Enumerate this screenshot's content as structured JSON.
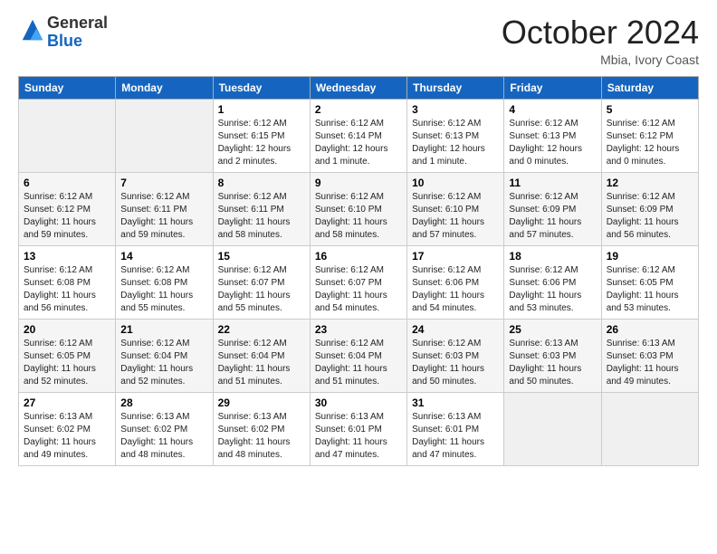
{
  "logo": {
    "general": "General",
    "blue": "Blue"
  },
  "header": {
    "month": "October 2024",
    "location": "Mbia, Ivory Coast"
  },
  "days_of_week": [
    "Sunday",
    "Monday",
    "Tuesday",
    "Wednesday",
    "Thursday",
    "Friday",
    "Saturday"
  ],
  "weeks": [
    [
      {
        "day": "",
        "info": ""
      },
      {
        "day": "",
        "info": ""
      },
      {
        "day": "1",
        "info": "Sunrise: 6:12 AM\nSunset: 6:15 PM\nDaylight: 12 hours and 2 minutes."
      },
      {
        "day": "2",
        "info": "Sunrise: 6:12 AM\nSunset: 6:14 PM\nDaylight: 12 hours and 1 minute."
      },
      {
        "day": "3",
        "info": "Sunrise: 6:12 AM\nSunset: 6:13 PM\nDaylight: 12 hours and 1 minute."
      },
      {
        "day": "4",
        "info": "Sunrise: 6:12 AM\nSunset: 6:13 PM\nDaylight: 12 hours and 0 minutes."
      },
      {
        "day": "5",
        "info": "Sunrise: 6:12 AM\nSunset: 6:12 PM\nDaylight: 12 hours and 0 minutes."
      }
    ],
    [
      {
        "day": "6",
        "info": "Sunrise: 6:12 AM\nSunset: 6:12 PM\nDaylight: 11 hours and 59 minutes."
      },
      {
        "day": "7",
        "info": "Sunrise: 6:12 AM\nSunset: 6:11 PM\nDaylight: 11 hours and 59 minutes."
      },
      {
        "day": "8",
        "info": "Sunrise: 6:12 AM\nSunset: 6:11 PM\nDaylight: 11 hours and 58 minutes."
      },
      {
        "day": "9",
        "info": "Sunrise: 6:12 AM\nSunset: 6:10 PM\nDaylight: 11 hours and 58 minutes."
      },
      {
        "day": "10",
        "info": "Sunrise: 6:12 AM\nSunset: 6:10 PM\nDaylight: 11 hours and 57 minutes."
      },
      {
        "day": "11",
        "info": "Sunrise: 6:12 AM\nSunset: 6:09 PM\nDaylight: 11 hours and 57 minutes."
      },
      {
        "day": "12",
        "info": "Sunrise: 6:12 AM\nSunset: 6:09 PM\nDaylight: 11 hours and 56 minutes."
      }
    ],
    [
      {
        "day": "13",
        "info": "Sunrise: 6:12 AM\nSunset: 6:08 PM\nDaylight: 11 hours and 56 minutes."
      },
      {
        "day": "14",
        "info": "Sunrise: 6:12 AM\nSunset: 6:08 PM\nDaylight: 11 hours and 55 minutes."
      },
      {
        "day": "15",
        "info": "Sunrise: 6:12 AM\nSunset: 6:07 PM\nDaylight: 11 hours and 55 minutes."
      },
      {
        "day": "16",
        "info": "Sunrise: 6:12 AM\nSunset: 6:07 PM\nDaylight: 11 hours and 54 minutes."
      },
      {
        "day": "17",
        "info": "Sunrise: 6:12 AM\nSunset: 6:06 PM\nDaylight: 11 hours and 54 minutes."
      },
      {
        "day": "18",
        "info": "Sunrise: 6:12 AM\nSunset: 6:06 PM\nDaylight: 11 hours and 53 minutes."
      },
      {
        "day": "19",
        "info": "Sunrise: 6:12 AM\nSunset: 6:05 PM\nDaylight: 11 hours and 53 minutes."
      }
    ],
    [
      {
        "day": "20",
        "info": "Sunrise: 6:12 AM\nSunset: 6:05 PM\nDaylight: 11 hours and 52 minutes."
      },
      {
        "day": "21",
        "info": "Sunrise: 6:12 AM\nSunset: 6:04 PM\nDaylight: 11 hours and 52 minutes."
      },
      {
        "day": "22",
        "info": "Sunrise: 6:12 AM\nSunset: 6:04 PM\nDaylight: 11 hours and 51 minutes."
      },
      {
        "day": "23",
        "info": "Sunrise: 6:12 AM\nSunset: 6:04 PM\nDaylight: 11 hours and 51 minutes."
      },
      {
        "day": "24",
        "info": "Sunrise: 6:12 AM\nSunset: 6:03 PM\nDaylight: 11 hours and 50 minutes."
      },
      {
        "day": "25",
        "info": "Sunrise: 6:13 AM\nSunset: 6:03 PM\nDaylight: 11 hours and 50 minutes."
      },
      {
        "day": "26",
        "info": "Sunrise: 6:13 AM\nSunset: 6:03 PM\nDaylight: 11 hours and 49 minutes."
      }
    ],
    [
      {
        "day": "27",
        "info": "Sunrise: 6:13 AM\nSunset: 6:02 PM\nDaylight: 11 hours and 49 minutes."
      },
      {
        "day": "28",
        "info": "Sunrise: 6:13 AM\nSunset: 6:02 PM\nDaylight: 11 hours and 48 minutes."
      },
      {
        "day": "29",
        "info": "Sunrise: 6:13 AM\nSunset: 6:02 PM\nDaylight: 11 hours and 48 minutes."
      },
      {
        "day": "30",
        "info": "Sunrise: 6:13 AM\nSunset: 6:01 PM\nDaylight: 11 hours and 47 minutes."
      },
      {
        "day": "31",
        "info": "Sunrise: 6:13 AM\nSunset: 6:01 PM\nDaylight: 11 hours and 47 minutes."
      },
      {
        "day": "",
        "info": ""
      },
      {
        "day": "",
        "info": ""
      }
    ]
  ]
}
